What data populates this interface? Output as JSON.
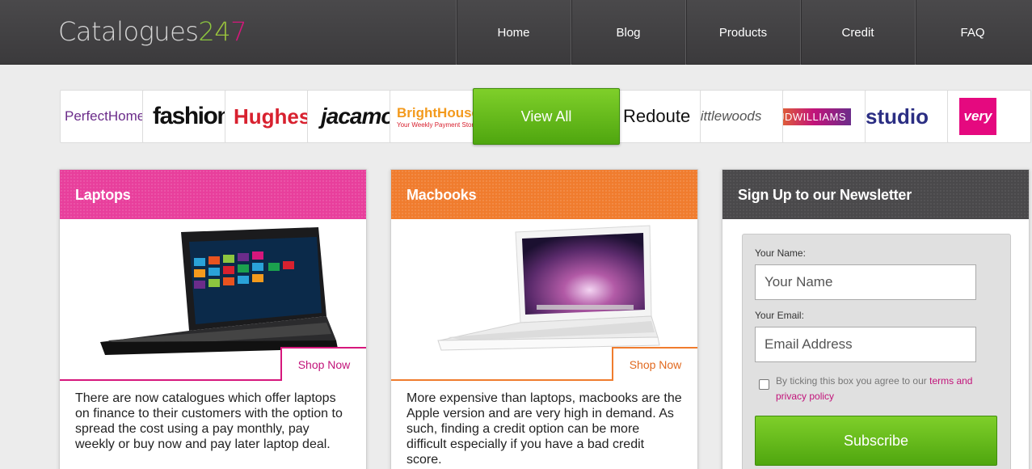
{
  "header": {
    "logo_text": "Catalogues",
    "logo_num_1": "2",
    "logo_num_2": "4",
    "logo_num_3": "7",
    "nav": [
      "Home",
      "Blog",
      "Products",
      "Credit",
      "FAQ"
    ]
  },
  "brands": {
    "items": [
      {
        "label": "PerfectHome",
        "color": "#6b2c8a"
      },
      {
        "label": "fashion",
        "color": "#111111"
      },
      {
        "label": "Hughes",
        "color": "#d8212f"
      },
      {
        "label": "jacamo",
        "color": "#111111"
      },
      {
        "label": "BrightHouse",
        "sub": "Your Weekly Payment Store",
        "color": "#f39a1d"
      },
      {
        "label": "Redoute",
        "color": "#111111"
      },
      {
        "label": "littlewoods",
        "color": "#555555"
      },
      {
        "label": "JDWILLIAMS",
        "color": "#ffffff"
      },
      {
        "label": "studio",
        "color": "#2b2e83"
      },
      {
        "label": "very",
        "color": "#ffffff"
      }
    ],
    "view_all": "View All"
  },
  "cards": [
    {
      "title": "Laptops",
      "shop": "Shop Now",
      "text": "There are now catalogues which offer laptops on finance to their customers with the option to spread the cost using a pay monthly, pay weekly or buy now and pay later laptop deal."
    },
    {
      "title": "Macbooks",
      "shop": "Shop Now",
      "text": "More expensive than laptops, macbooks are the Apple version and are very high in demand. As such, finding a credit option can be more difficult especially if you have a bad credit score."
    }
  ],
  "newsletter": {
    "title": "Sign Up to our Newsletter",
    "name_label": "Your Name:",
    "name_placeholder": "Your Name",
    "email_label": "Your Email:",
    "email_placeholder": "Email Address",
    "consent_prefix": "By ticking this box you agree to our ",
    "consent_link": "terms and privacy policy",
    "subscribe": "Subscribe"
  },
  "colors": {
    "accent_pink": "#e83f9c",
    "accent_orange": "#f07c2e",
    "accent_green": "#5fb81a",
    "header_bg": "#434244"
  }
}
